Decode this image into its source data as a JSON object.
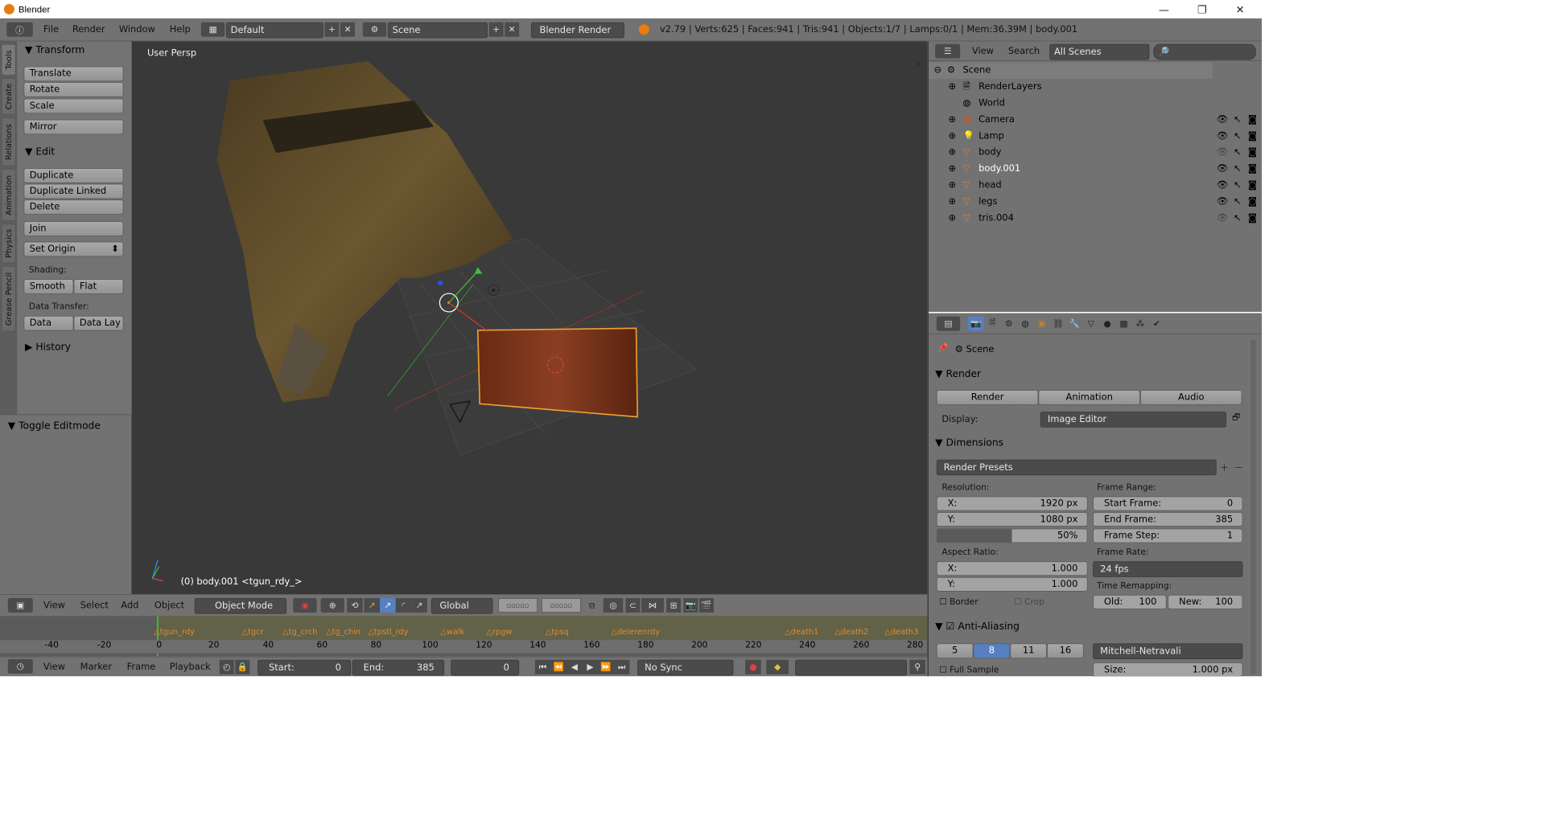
{
  "window": {
    "title": "Blender"
  },
  "infobar": {
    "menus": [
      "File",
      "Render",
      "Window",
      "Help"
    ],
    "screen_layout": "Default",
    "scene": "Scene",
    "engine": "Blender Render",
    "stats": "v2.79 | Verts:625 | Faces:941 | Tris:941 | Objects:1/7 | Lamps:0/1 | Mem:36.39M | body.001"
  },
  "tool_tabs": [
    "Tools",
    "Create",
    "Relations",
    "Animation",
    "Physics",
    "Grease Pencil"
  ],
  "tools": {
    "transform_header": "Transform",
    "translate": "Translate",
    "rotate": "Rotate",
    "scale": "Scale",
    "mirror": "Mirror",
    "edit_header": "Edit",
    "duplicate": "Duplicate",
    "duplicate_linked": "Duplicate Linked",
    "delete": "Delete",
    "join": "Join",
    "set_origin": "Set Origin",
    "shading_label": "Shading:",
    "smooth": "Smooth",
    "flat": "Flat",
    "data_transfer_label": "Data Transfer:",
    "data": "Data",
    "data_lay": "Data Lay",
    "history_header": "History",
    "toggle_editmode": "Toggle Editmode"
  },
  "viewport": {
    "persp_label": "User Persp",
    "object_label": "(0) body.001 <tgun_rdy_>"
  },
  "view3d_header": {
    "menus": [
      "View",
      "Select",
      "Add",
      "Object"
    ],
    "mode": "Object Mode",
    "orientation": "Global"
  },
  "timeline": {
    "ruler_ticks": [
      "-40",
      "-20",
      "0",
      "20",
      "40",
      "60",
      "80",
      "100",
      "120",
      "140",
      "160",
      "180",
      "200",
      "220",
      "240",
      "260",
      "280"
    ],
    "markers": [
      "tgun_rdy",
      "tgcr",
      "tg_crch",
      "tg_chin",
      "tpstl_rdy",
      "walk",
      "rpgw",
      "tpsq",
      "delerenrdy",
      "death1",
      "death2",
      "death3"
    ],
    "menus": [
      "View",
      "Marker",
      "Frame",
      "Playback"
    ],
    "start_label": "Start:",
    "start": "0",
    "end_label": "End:",
    "end": "385",
    "current": "0",
    "sync": "No Sync"
  },
  "outliner": {
    "menus": [
      "View",
      "Search"
    ],
    "filter": "All Scenes",
    "items": [
      {
        "label": "Scene",
        "indent": 0
      },
      {
        "label": "RenderLayers",
        "indent": 1
      },
      {
        "label": "World",
        "indent": 1
      },
      {
        "label": "Camera",
        "indent": 1
      },
      {
        "label": "Lamp",
        "indent": 1
      },
      {
        "label": "body",
        "indent": 1
      },
      {
        "label": "body.001",
        "indent": 1
      },
      {
        "label": "head",
        "indent": 1
      },
      {
        "label": "legs",
        "indent": 1
      },
      {
        "label": "tris.004",
        "indent": 1
      }
    ]
  },
  "properties": {
    "context": "Scene",
    "render_header": "Render",
    "render_btn": "Render",
    "animation_btn": "Animation",
    "audio_btn": "Audio",
    "display_label": "Display:",
    "display_value": "Image Editor",
    "dimensions_header": "Dimensions",
    "render_presets": "Render Presets",
    "resolution_label": "Resolution:",
    "res_x_label": "X:",
    "res_x": "1920 px",
    "res_y_label": "Y:",
    "res_y": "1080 px",
    "res_pct": "50%",
    "frame_range_label": "Frame Range:",
    "start_frame_label": "Start Frame:",
    "start_frame": "0",
    "end_frame_label": "End Frame:",
    "end_frame": "385",
    "frame_step_label": "Frame Step:",
    "frame_step": "1",
    "aspect_label": "Aspect Ratio:",
    "asp_x_label": "X:",
    "asp_x": "1.000",
    "asp_y_label": "Y:",
    "asp_y": "1.000",
    "frame_rate_label": "Frame Rate:",
    "frame_rate": "24 fps",
    "time_remap_label": "Time Remapping:",
    "old_label": "Old:",
    "old": "100",
    "new_label": "New:",
    "new": "100",
    "border": "Border",
    "crop": "Crop",
    "aa_header": "Anti-Aliasing",
    "aa_samples": [
      "5",
      "8",
      "11",
      "16"
    ],
    "aa_filter": "Mitchell-Netravali",
    "full_sample": "Full Sample",
    "size_label": "Size:",
    "size": "1.000 px"
  },
  "colors": {
    "selected": "#5680c2",
    "panel": "#727272",
    "viewport": "#393939",
    "selection_outline": "#f0a030"
  }
}
